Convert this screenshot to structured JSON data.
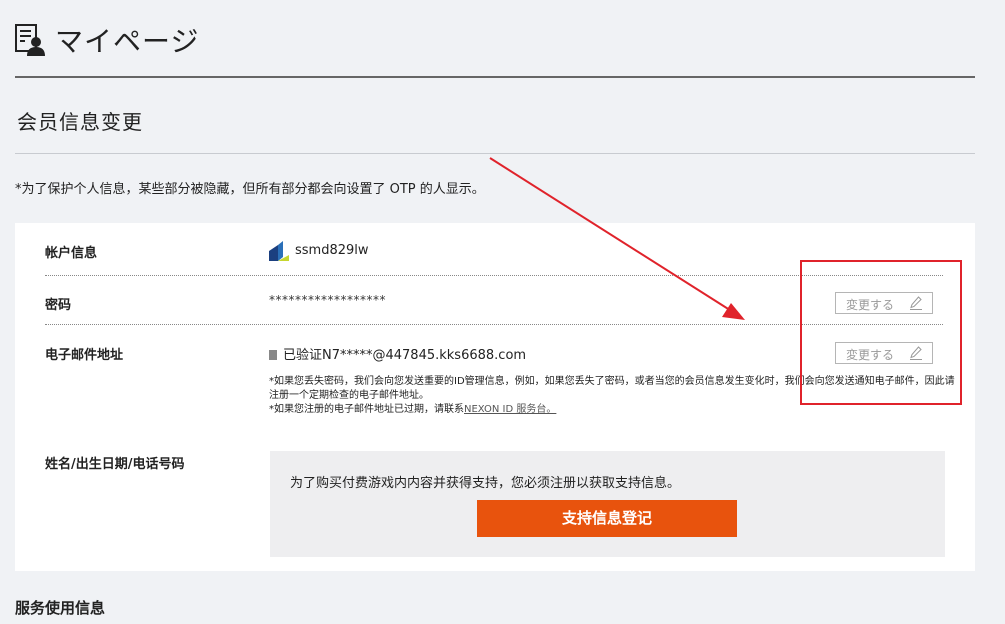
{
  "page": {
    "title": "マイページ"
  },
  "section": {
    "title": "会员信息变更"
  },
  "privacy_note": "*为了保护个人信息，某些部分被隐藏，但所有部分都会向设置了 OTP 的人显示。",
  "account": {
    "label": "帐户信息",
    "id": "ssmd829lw"
  },
  "password": {
    "label": "密码",
    "value": "******************",
    "change_label": "変更する"
  },
  "email": {
    "label": "电子邮件地址",
    "value": "已验证N7*****@447845.kks6688.com",
    "change_label": "変更する",
    "note1": "*如果您丢失密码，我们会向您发送重要的ID管理信息，例如，如果您丢失了密码，或者当您的会员信息发生变化时，我们会向您发送通知电子邮件，因此请注册一个定期检查的电子邮件地址。",
    "note2_prefix": "*如果您注册的电子邮件地址已过期，请联系",
    "note2_link": "NEXON ID 服务台。"
  },
  "personal": {
    "label": "姓名/出生日期/电话号码",
    "support_text": "为了购买付费游戏内内容并获得支持，您必须注册以获取支持信息。",
    "support_button": "支持信息登记"
  },
  "service": {
    "title": "服务使用信息"
  },
  "colors": {
    "accent": "#e8530d",
    "highlight": "#e0232b",
    "background": "#f0f2f5"
  },
  "icons": [
    "profile-document-icon",
    "nexon-logo-icon",
    "pencil-icon",
    "arrow-annotation"
  ]
}
